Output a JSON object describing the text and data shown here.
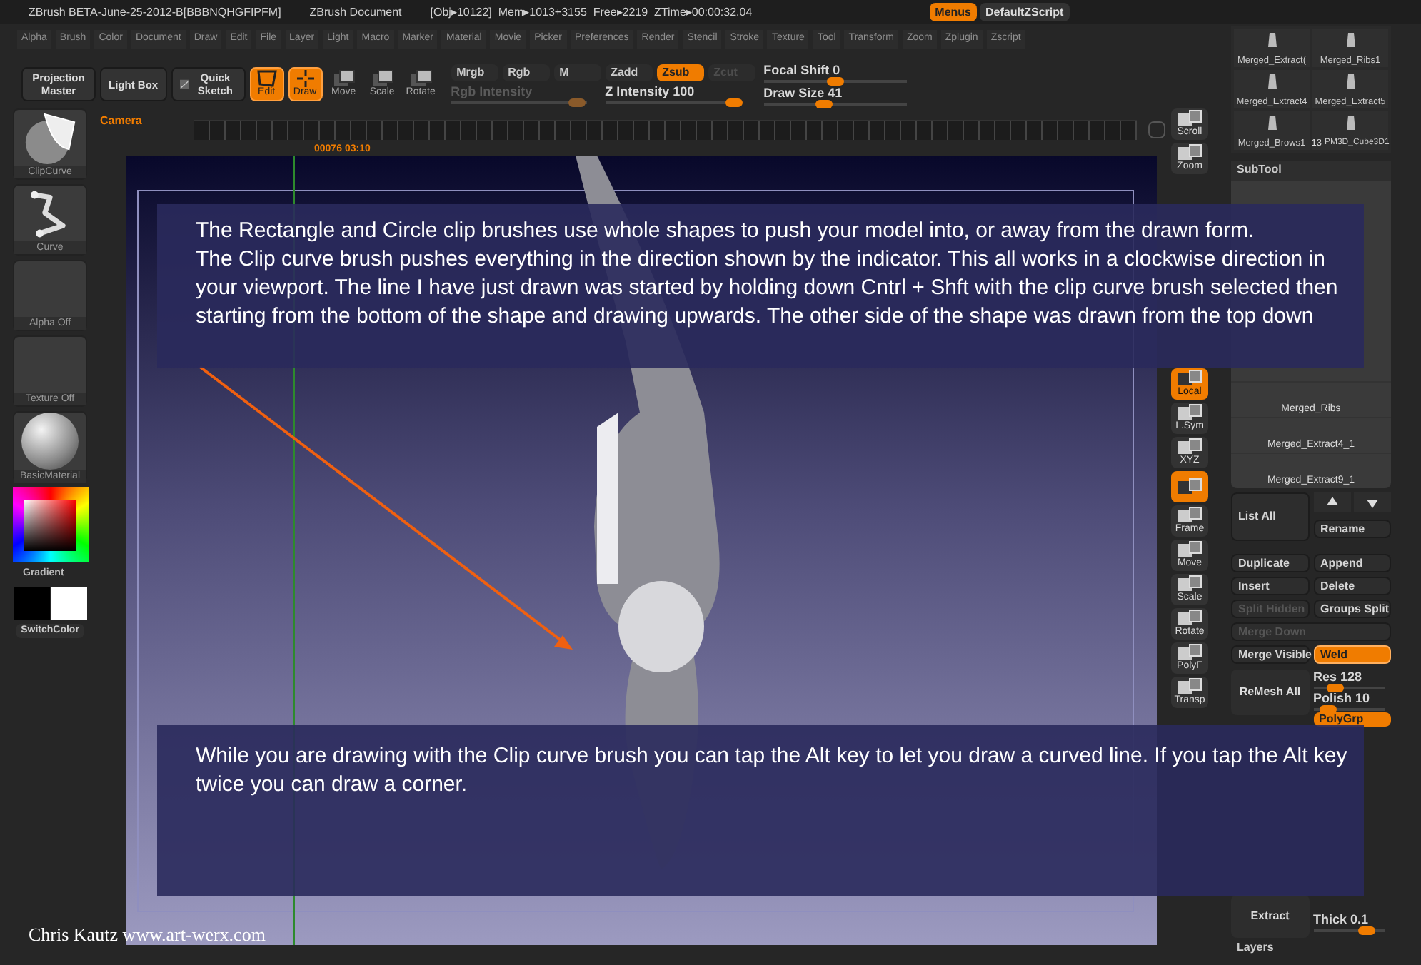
{
  "title_bar": {
    "app_title": "ZBrush BETA-June-25-2012-B[BBBNQHGFIPFM]",
    "document": "ZBrush Document",
    "stats": "[Obj▸10122]  Mem▸1013+3155  Free▸2219  ZTime▸00:00:32.04",
    "buttons": [
      {
        "label": "Menus",
        "selected": true
      },
      {
        "label": "DefaultZScript",
        "selected": false
      }
    ]
  },
  "menu_bar": [
    "Alpha",
    "Brush",
    "Color",
    "Document",
    "Draw",
    "Edit",
    "File",
    "Layer",
    "Light",
    "Macro",
    "Marker",
    "Material",
    "Movie",
    "Picker",
    "Preferences",
    "Render",
    "Stencil",
    "Stroke",
    "Texture",
    "Tool",
    "Transform",
    "Zoom",
    "Zplugin",
    "Zscript"
  ],
  "toolbar": {
    "buttons": [
      {
        "label": "Projection Master",
        "kind": "text"
      },
      {
        "label": "Light Box",
        "kind": "text"
      },
      {
        "label": "Quick Sketch",
        "kind": "sketch"
      }
    ],
    "modes": [
      {
        "label": "Edit",
        "kind": "edit",
        "selected": true
      },
      {
        "label": "Draw",
        "kind": "draw",
        "selected": true
      },
      {
        "label": "Move",
        "kind": "move",
        "selected": false
      },
      {
        "label": "Scale",
        "kind": "scale",
        "selected": false
      },
      {
        "label": "Rotate",
        "kind": "rotate",
        "selected": false
      }
    ],
    "channels": [
      {
        "label": "Mrgb",
        "selected": false,
        "disabled": false
      },
      {
        "label": "Rgb",
        "selected": false,
        "disabled": false
      },
      {
        "label": "M",
        "selected": false,
        "disabled": false
      },
      {
        "label": "Zadd",
        "selected": false,
        "disabled": false
      },
      {
        "label": "Zsub",
        "selected": true,
        "disabled": false
      },
      {
        "label": "Zcut",
        "selected": false,
        "disabled": true
      }
    ],
    "sliders": [
      {
        "label": "Rgb Intensity",
        "level": 0.93,
        "disabled": true
      },
      {
        "label": "Z Intensity 100",
        "level": 0.95,
        "disabled": false
      },
      {
        "label": "Focal Shift 0",
        "level": 0.5,
        "disabled": false
      },
      {
        "label": "Draw Size 41",
        "level": 0.42,
        "disabled": false
      }
    ]
  },
  "camera": {
    "label": "Camera",
    "readouts": [
      "00076",
      "03:10"
    ]
  },
  "left_panel": {
    "thumbnails": [
      {
        "label": "ClipCurve",
        "kind": "clip"
      },
      {
        "label": "Curve",
        "kind": "curve"
      },
      {
        "label": "Alpha Off",
        "kind": "empty"
      },
      {
        "label": "Texture Off",
        "kind": "empty"
      },
      {
        "label": "BasicMaterial",
        "kind": "sphere"
      }
    ],
    "gradient_label": "Gradient",
    "switch_label": "SwitchColor"
  },
  "right_shelf_top": [
    {
      "label": "Scroll",
      "selected": false
    },
    {
      "label": "Zoom",
      "selected": false
    }
  ],
  "right_shelf": [
    {
      "label": "Local",
      "selected": true
    },
    {
      "label": "L.Sym",
      "selected": false
    },
    {
      "label": "XYZ",
      "selected": false
    },
    {
      "selected": true
    },
    {
      "label": "Frame",
      "selected": false
    },
    {
      "label": "Move",
      "selected": false
    },
    {
      "label": "Scale",
      "selected": false
    },
    {
      "label": "Rotate",
      "selected": false
    },
    {
      "label": "PolyF",
      "selected": false
    },
    {
      "label": "Transp",
      "selected": false
    }
  ],
  "tool_panel": {
    "tools": [
      {
        "label": "Merged_Extract("
      },
      {
        "label": "Merged_Ribs1"
      },
      {
        "label": "Merged_Extract4"
      },
      {
        "label": "Merged_Extract5"
      },
      {
        "label": "Merged_Brows1"
      },
      {
        "label": "PM3D_Cube3D1",
        "count": "13"
      }
    ],
    "subtool_title": "SubTool",
    "subtools": [
      "Merged_Ribs",
      "Merged_Extract4_1",
      "Merged_Extract9_1"
    ],
    "buttons": [
      {
        "label": "List All",
        "kind": "tall"
      },
      {
        "label": "Rename",
        "kind": "half"
      },
      {
        "label": "Duplicate",
        "kind": "half"
      },
      {
        "label": "Append",
        "kind": "half"
      },
      {
        "label": "Insert",
        "kind": "half"
      },
      {
        "label": "Delete",
        "kind": "half"
      },
      {
        "label": "Split Hidden",
        "kind": "half",
        "disabled": true
      },
      {
        "label": "Groups Split",
        "kind": "half"
      },
      {
        "label": "Merge Down",
        "kind": "full",
        "disabled": true
      },
      {
        "label": "Merge Visible",
        "kind": "half"
      },
      {
        "label": "Weld",
        "kind": "half",
        "on": true
      }
    ],
    "remesh": {
      "button": "ReMesh All",
      "sliders": [
        {
          "label": "Res 128",
          "level": 0.3
        },
        {
          "label": "Polish 10",
          "level": 0.2
        }
      ],
      "toggle": {
        "label": "PolyGrp",
        "on": true
      }
    },
    "extract": {
      "button": "Extract",
      "thick": {
        "label": "Thick 0.1",
        "level": 0.75
      }
    },
    "layers_title": "Layers"
  },
  "notes": [
    [
      "The Rectangle and Circle clip brushes use whole shapes to push your model into, or away from the drawn form.",
      "The Clip curve brush pushes everything in the direction shown by the indicator. This all works in a clockwise direction in your viewport. The line I have just drawn was started by holding down Cntrl + Shft with the clip curve brush selected then starting from the bottom of the shape and drawing upwards. The other side of the shape was drawn from the top down"
    ],
    [
      "While you are drawing with the Clip curve brush you can tap the Alt key to let you draw a curved line. If you tap the Alt key twice you can draw a corner."
    ]
  ],
  "credit": "Chris Kautz www.art-werx.com"
}
